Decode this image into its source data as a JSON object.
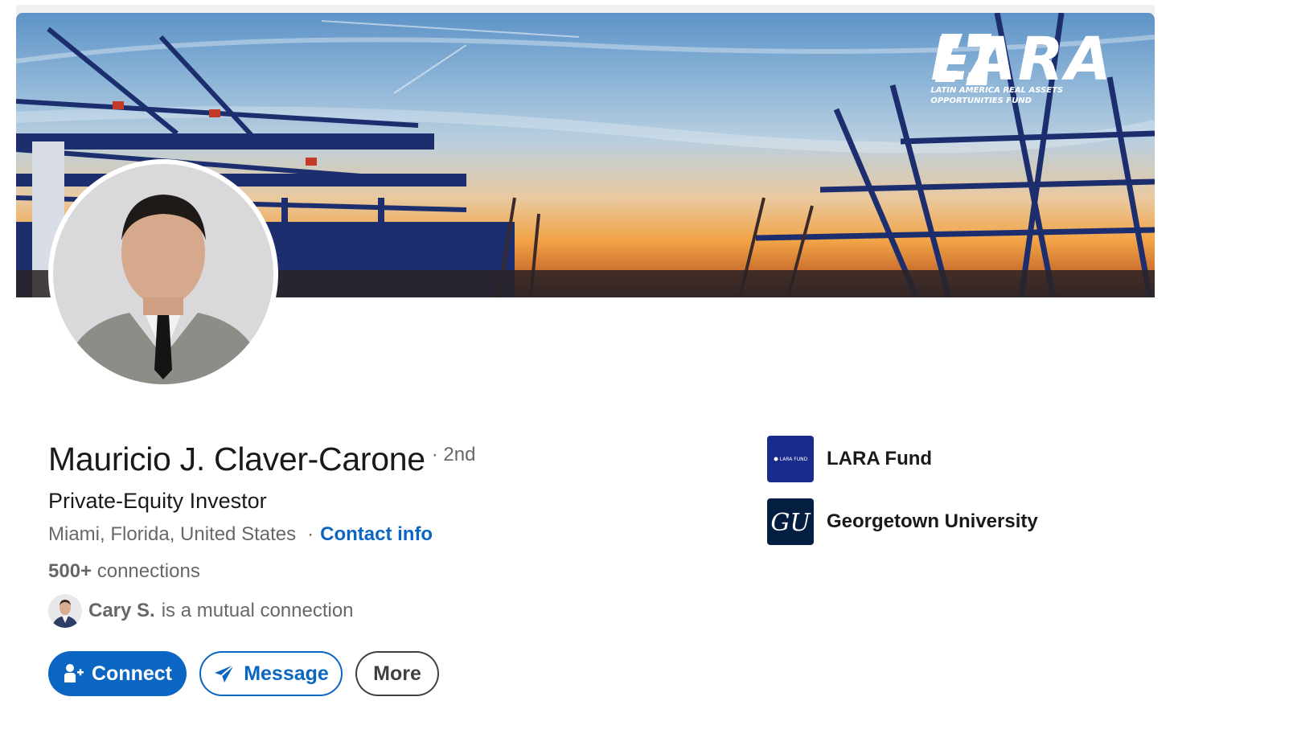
{
  "banner": {
    "brand_name": "LARA",
    "brand_tagline": "LATIN AMERICA REAL ASSETS OPPORTUNITIES FUND"
  },
  "profile": {
    "name": "Mauricio J. Claver-Carone",
    "degree": "· 2nd",
    "headline": "Private-Equity Investor",
    "location": "Miami, Florida, United States",
    "location_separator": "·",
    "contact_info_label": "Contact info",
    "connections_count": "500+",
    "connections_label": "connections",
    "mutual_name": "Cary S.",
    "mutual_text": "is a mutual connection"
  },
  "actions": {
    "connect_label": "Connect",
    "message_label": "Message",
    "more_label": "More"
  },
  "side": {
    "items": [
      {
        "label": "LARA Fund",
        "logo_text": "LARA FUND"
      },
      {
        "label": "Georgetown University",
        "logo_text": "GU"
      }
    ]
  },
  "colors": {
    "accent": "#0a66c2",
    "lara_logo_bg": "#1a2b8c",
    "gu_logo_bg": "#041e42"
  },
  "icons": [
    "add-person-icon",
    "send-icon"
  ]
}
